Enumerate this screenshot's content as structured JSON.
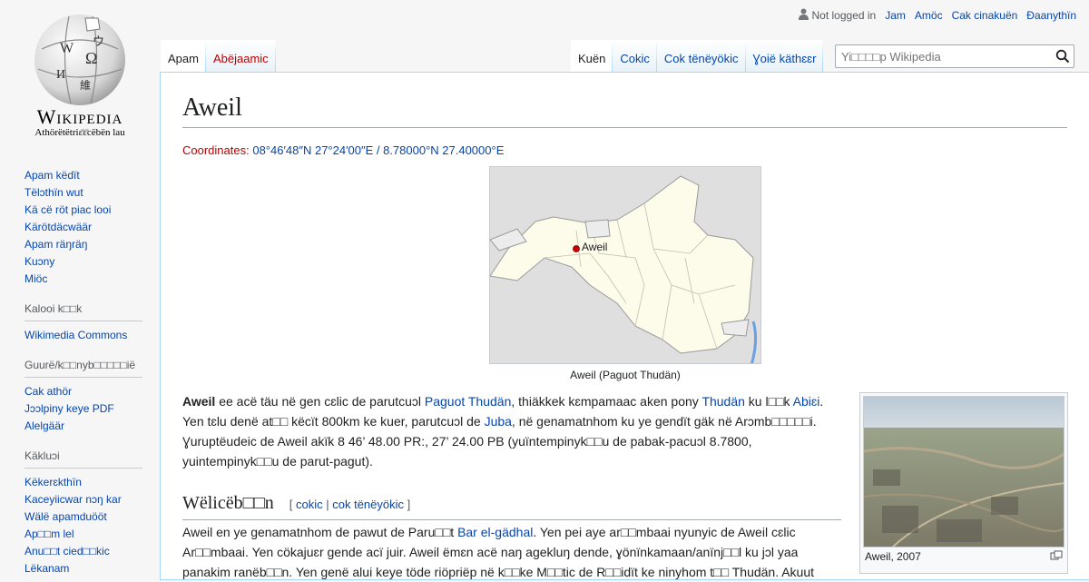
{
  "logo": {
    "wordmark": "Wikipedia",
    "tagline": "Athörëtëtriɛ̈ɛ̈cëbën lau"
  },
  "personal": {
    "not_logged_in": "Not logged in",
    "links": [
      "Jam",
      "Amöc",
      "Cak cinakuën",
      "Ɖaanythïn"
    ]
  },
  "tabs_left": [
    {
      "label": "Apam",
      "selected": true
    },
    {
      "label": "Abëjaamic",
      "selected": false,
      "new": true
    }
  ],
  "tabs_right": [
    {
      "label": "Kuën",
      "selected": true
    },
    {
      "label": "Cokic",
      "selected": false
    },
    {
      "label": "Cok tënëyökic",
      "selected": false
    },
    {
      "label": "Ɣoië käthɛɛr",
      "selected": false
    }
  ],
  "search": {
    "placeholder": "Yi□□□□p Wikipedia"
  },
  "sidebar": {
    "navigation": [
      "Apam këdït",
      "Tëlɔthïn wut",
      "Kä cë röt piac looi",
      "Kärötdäcwäär",
      "Apam räŋräŋ",
      "Kuɔny",
      "Miöc"
    ],
    "sections": [
      {
        "heading": "Kalooi k□□k",
        "items": [
          "Wikimedia Commons"
        ]
      },
      {
        "heading": "Guurë/k□□nyb□□□□□ië",
        "items": [
          "Cak athör",
          "Jɔɔlpiny keye PDF",
          "Alelgäär"
        ]
      },
      {
        "heading": "Käkluɔi",
        "items": [
          "Këkerɛkthïn",
          "Kaceyiicwar nɔŋ kar",
          "Wälë apamduööt",
          "Ap□□m lel",
          "Anu□□t cied□□kic",
          "Lëkanam"
        ]
      }
    ]
  },
  "article": {
    "title": "Aweil",
    "coords_label": "Coordinates",
    "coords_value": "08°46′48″N 27°24′00″E / 8.78000°N 27.40000°E",
    "map_label": "Aweil",
    "map_caption": "Aweil (Paguot Thudän)",
    "para1": {
      "bold": "Aweil",
      "t1": " ee acë täu në gen cɛlic de parutcuɔl ",
      "link1": "Paguot Thudän",
      "t2": ", thiäkkek kɛmpamaac aken pony ",
      "link2": "Thudän",
      "t3": " ku l□□k ",
      "link3": "Abiɛi",
      "t4": ". Yen tɛlu denë at□□ këcït 800km ke kuer, parutcuɔl de ",
      "link4": "Juba",
      "t5": ", në genamatnhom ku ye gendït gäk në Arɔmb□□□□□i. Ɣuruptëudeic de Aweil akïk 8 46’ 48.00 PR:, 27’ 24.00 PB (yuïntempinyk□□u de pabak-pacuɔl 8.7800, yuintempinyk□□u de parut-pagut)."
    },
    "section_title": "Wëlicëb□□n",
    "section_edit": {
      "open": "[ ",
      "edit": "cokic",
      "sep": " | ",
      "edit_source": "cok tënëyökic",
      "close": " ]"
    },
    "para2": {
      "t1": "Aweil en ye genamatnhom de pawut de Paru□□t ",
      "link1": "Bar el-gädhal",
      "t2": ". Yen pei aye ar□□mbaai nyunyic de Aweil cɛlic Ar□□mbaai. Yen cökajuɛr  gende acï juir. Aweil ëmɛn acë naŋ agekluŋ dende, ɣönïnkamaan/anïnj□□l ku jɔl yaa panakim ranëb□□n. Yen genë alui keye töde riöpriëp në k□□ke M□□tic de R□□idït ke ninyhom t□□ Thudän. Akuut"
    },
    "thumb_caption": "Aweil, 2007"
  }
}
